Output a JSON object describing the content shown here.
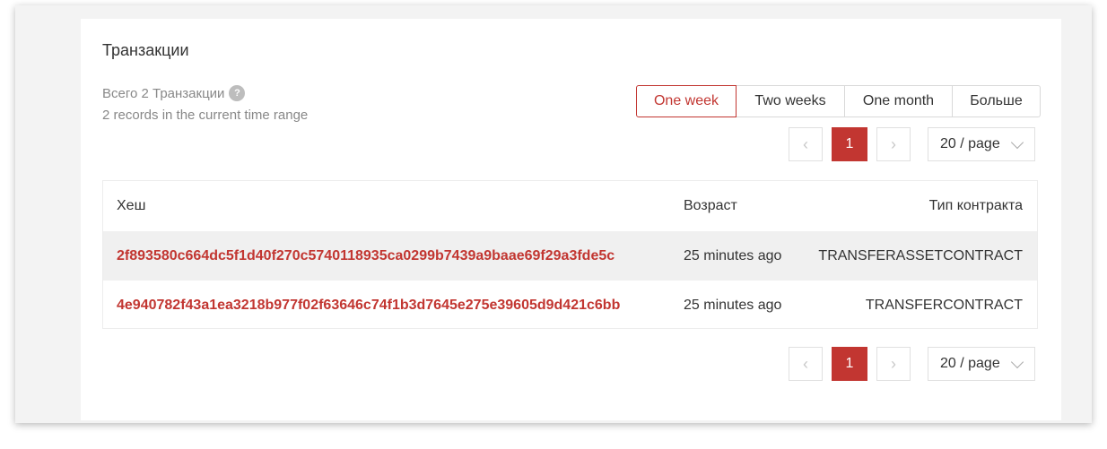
{
  "title": "Транзакции",
  "summary": {
    "total": "Всего 2 Транзакции",
    "help_icon": "?",
    "range_note": "2 records in the current time range"
  },
  "range_tabs": [
    {
      "label": "One week",
      "selected": true
    },
    {
      "label": "Two weeks",
      "selected": false
    },
    {
      "label": "One month",
      "selected": false
    },
    {
      "label": "Больше",
      "selected": false
    }
  ],
  "pagination": {
    "prev_icon": "‹",
    "next_icon": "›",
    "current_page": "1",
    "page_size": "20 / page"
  },
  "table": {
    "columns": [
      "Хеш",
      "Возраст",
      "Тип контракта"
    ],
    "rows": [
      {
        "hash": "2f893580c664dc5f1d40f270c5740118935ca0299b7439a9baae69f29a3fde5c",
        "age": "25 minutes ago",
        "type": "TRANSFERASSETCONTRACT"
      },
      {
        "hash": "4e940782f43a1ea3218b977f02f63646c74f1b3d7645e275e39605d9d421c6bb",
        "age": "25 minutes ago",
        "type": "TRANSFERCONTRACT"
      }
    ]
  },
  "colors": {
    "accent": "#c23631",
    "muted": "#888888"
  }
}
